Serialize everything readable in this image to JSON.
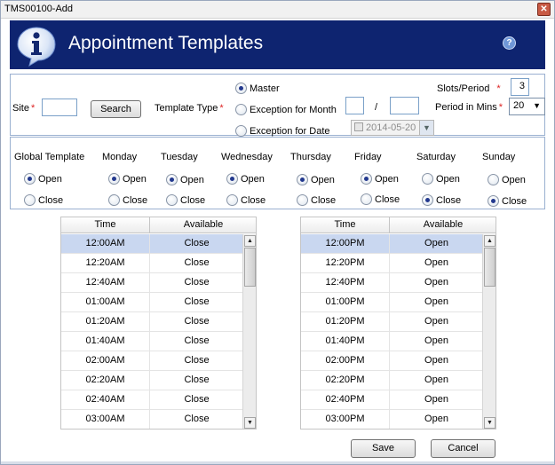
{
  "window": {
    "title": "TMS00100-Add",
    "close_icon": "close-icon"
  },
  "header": {
    "title": "Appointment Templates",
    "info_icon": "info-icon",
    "help_icon": "help-icon",
    "help_glyph": "?"
  },
  "criteria": {
    "site_label": "Site",
    "site_value": "",
    "search_label": "Search",
    "template_type_label": "Template Type",
    "template_types": [
      {
        "label": "Master",
        "selected": true
      },
      {
        "label": "Exception for Month",
        "selected": false
      },
      {
        "label": "Exception for Date",
        "selected": false
      }
    ],
    "month_value": "",
    "year_value": "",
    "date_separator": "/",
    "date_value": "2014-05-20",
    "slots_label": "Slots/Period",
    "slots_value": "3",
    "period_label": "Period in Mins",
    "period_value": "20",
    "required_mark": "*"
  },
  "days": {
    "open_label": "Open",
    "close_label": "Close",
    "items": [
      {
        "name": "Global Template",
        "open": true
      },
      {
        "name": "Monday",
        "open": true
      },
      {
        "name": "Tuesday",
        "open": true
      },
      {
        "name": "Wednesday",
        "open": true
      },
      {
        "name": "Thursday",
        "open": true
      },
      {
        "name": "Friday",
        "open": true
      },
      {
        "name": "Saturday",
        "open": false
      },
      {
        "name": "Sunday",
        "open": false
      }
    ]
  },
  "tables": {
    "columns": [
      "Time",
      "Available"
    ],
    "left": [
      [
        "12:00AM",
        "Close"
      ],
      [
        "12:20AM",
        "Close"
      ],
      [
        "12:40AM",
        "Close"
      ],
      [
        "01:00AM",
        "Close"
      ],
      [
        "01:20AM",
        "Close"
      ],
      [
        "01:40AM",
        "Close"
      ],
      [
        "02:00AM",
        "Close"
      ],
      [
        "02:20AM",
        "Close"
      ],
      [
        "02:40AM",
        "Close"
      ],
      [
        "03:00AM",
        "Close"
      ]
    ],
    "right": [
      [
        "12:00PM",
        "Open"
      ],
      [
        "12:20PM",
        "Open"
      ],
      [
        "12:40PM",
        "Open"
      ],
      [
        "01:00PM",
        "Open"
      ],
      [
        "01:20PM",
        "Open"
      ],
      [
        "01:40PM",
        "Open"
      ],
      [
        "02:00PM",
        "Open"
      ],
      [
        "02:20PM",
        "Open"
      ],
      [
        "02:40PM",
        "Open"
      ],
      [
        "03:00PM",
        "Open"
      ]
    ]
  },
  "footer": {
    "save_label": "Save",
    "cancel_label": "Cancel"
  },
  "colors": {
    "header_bg": "#0e2470",
    "selected_row": "#c9d7f0",
    "required": "#d22222"
  }
}
